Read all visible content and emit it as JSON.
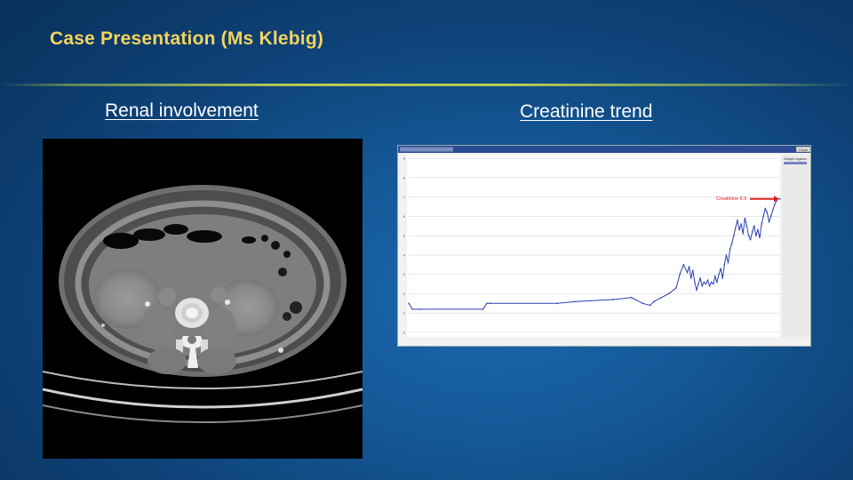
{
  "slide": {
    "title": "Case Presentation (Ms Klebig)"
  },
  "left_panel": {
    "caption": "Renal involvement"
  },
  "right_panel": {
    "caption": "Creatinine trend",
    "annotation": "Creatinine 6.9",
    "close_label": "Close",
    "legend_title": "Graph Legend"
  },
  "colors": {
    "title": "#f4d35e",
    "divider": "#b8cc50",
    "series": "#2b3fb0",
    "annotation": "#d92020"
  },
  "chart_data": {
    "type": "line",
    "title": "",
    "xlabel": "",
    "ylabel": "",
    "ylim": [
      0,
      9
    ],
    "yticks": [
      0,
      1,
      2,
      3,
      4,
      5,
      6,
      7,
      8,
      9
    ],
    "grid": true,
    "annotation": {
      "text": "Creatinine 6.9",
      "value": 6.9
    },
    "series": [
      {
        "x": [
          0,
          1,
          3,
          20,
          21,
          22,
          40,
          45,
          55,
          60,
          63,
          65,
          66,
          68,
          70,
          72,
          73,
          74,
          75,
          75.5,
          76,
          76.5,
          77,
          77.5,
          78,
          78.5,
          79,
          79.5,
          80,
          80.5,
          81,
          81.5,
          82,
          82.5,
          83,
          83.5,
          84,
          84.5,
          85,
          85.5,
          86,
          86.5,
          87,
          87.5,
          88,
          88.5,
          89,
          89.5,
          90,
          90.5,
          91,
          91.5,
          92,
          92.5,
          93,
          93.5,
          94,
          94.5,
          95,
          95.5,
          96,
          96.5,
          97,
          97.5,
          98,
          98.5,
          99,
          99.5,
          100
        ],
        "y": [
          1.5,
          1.2,
          1.2,
          1.2,
          1.5,
          1.5,
          1.5,
          1.6,
          1.7,
          1.8,
          1.5,
          1.4,
          1.6,
          1.8,
          2.0,
          2.3,
          3.0,
          3.5,
          3.1,
          3.4,
          2.8,
          3.2,
          2.6,
          2.2,
          2.5,
          2.8,
          2.4,
          2.6,
          2.5,
          2.7,
          2.4,
          2.6,
          2.5,
          2.9,
          2.6,
          3.0,
          3.3,
          2.8,
          3.5,
          4.0,
          3.6,
          4.3,
          4.6,
          5.0,
          5.4,
          5.8,
          5.3,
          5.6,
          5.1,
          5.9,
          5.5,
          5.0,
          4.8,
          5.2,
          5.5,
          5.0,
          5.3,
          4.9,
          5.6,
          6.0,
          6.4,
          6.2,
          5.7,
          6.0,
          6.3,
          6.6,
          6.8,
          6.9,
          6.9
        ]
      }
    ]
  }
}
